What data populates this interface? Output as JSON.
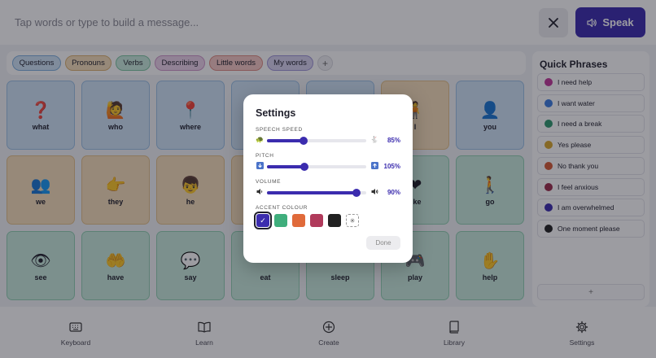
{
  "top": {
    "placeholder": "Tap words or type to build a message...",
    "clear_icon": "close-icon",
    "speak_label": "Speak",
    "speak_icon": "speaker-icon",
    "accent": "#3b2cae"
  },
  "categories": [
    {
      "label": "Questions",
      "color": "#cfe3f7",
      "border": "#7fb0de"
    },
    {
      "label": "Pronouns",
      "color": "#f6dfba",
      "border": "#dcb270"
    },
    {
      "label": "Verbs",
      "color": "#c9ebdc",
      "border": "#7cc6a3"
    },
    {
      "label": "Describing",
      "color": "#ecd2ea",
      "border": "#cf97ca"
    },
    {
      "label": "Little words",
      "color": "#f6c9c4",
      "border": "#df8c83"
    },
    {
      "label": "My words",
      "color": "#d7d2f0",
      "border": "#9f94d8"
    }
  ],
  "add_category_label": "+",
  "tiles": [
    {
      "label": "what",
      "emoji": "❓",
      "cat": "blue"
    },
    {
      "label": "who",
      "emoji": "🙋",
      "cat": "blue"
    },
    {
      "label": "where",
      "emoji": "📍",
      "cat": "blue"
    },
    {
      "label": "",
      "emoji": "",
      "cat": "blue"
    },
    {
      "label": "",
      "emoji": "",
      "cat": "blue"
    },
    {
      "label": "I",
      "emoji": "🧍",
      "cat": "tan"
    },
    {
      "label": "you",
      "emoji": "👤",
      "cat": "blue"
    },
    {
      "label": "we",
      "emoji": "👥",
      "cat": "tan"
    },
    {
      "label": "they",
      "emoji": "👉",
      "cat": "tan"
    },
    {
      "label": "he",
      "emoji": "👦",
      "cat": "tan"
    },
    {
      "label": "",
      "emoji": "",
      "cat": "tan"
    },
    {
      "label": "",
      "emoji": "",
      "cat": "tan"
    },
    {
      "label": "like",
      "emoji": "❤",
      "cat": "green"
    },
    {
      "label": "go",
      "emoji": "🚶",
      "cat": "green"
    },
    {
      "label": "see",
      "emoji": "👁",
      "cat": "green"
    },
    {
      "label": "have",
      "emoji": "🤲",
      "cat": "green"
    },
    {
      "label": "say",
      "emoji": "💬",
      "cat": "green"
    },
    {
      "label": "eat",
      "emoji": "",
      "cat": "green"
    },
    {
      "label": "sleep",
      "emoji": "",
      "cat": "green"
    },
    {
      "label": "play",
      "emoji": "🎮",
      "cat": "green"
    },
    {
      "label": "help",
      "emoji": "✋",
      "cat": "green"
    }
  ],
  "quick_phrases": {
    "title": "Quick Phrases",
    "items": [
      {
        "label": "I need help",
        "color": "#c2389a"
      },
      {
        "label": "I want water",
        "color": "#3b7de0"
      },
      {
        "label": "I need a break",
        "color": "#2f9a6e"
      },
      {
        "label": "Yes please",
        "color": "#d9a72c"
      },
      {
        "label": "No thank you",
        "color": "#d65a35"
      },
      {
        "label": "I feel anxious",
        "color": "#9b2b4a"
      },
      {
        "label": "I am overwhelmed",
        "color": "#3b2cae"
      },
      {
        "label": "One moment please",
        "color": "#222222"
      }
    ],
    "add_label": "+"
  },
  "nav": [
    {
      "label": "Keyboard",
      "icon": "keyboard-icon"
    },
    {
      "label": "Learn",
      "icon": "book-open-icon"
    },
    {
      "label": "Create",
      "icon": "plus-circle-icon"
    },
    {
      "label": "Library",
      "icon": "library-icon"
    },
    {
      "label": "Settings",
      "icon": "gear-icon"
    }
  ],
  "settings": {
    "title": "Settings",
    "speech_speed": {
      "label": "SPEECH SPEED",
      "value_text": "85%",
      "value": 0.37,
      "icon_left": "turtle-icon",
      "icon_right": "rabbit-icon"
    },
    "pitch": {
      "label": "PITCH",
      "value_text": "105%",
      "value": 0.38,
      "icon_left": "pitch-down-icon",
      "icon_right": "pitch-up-icon"
    },
    "volume": {
      "label": "VOLUME",
      "value_text": "90%",
      "value": 0.9,
      "icon_left": "volume-low-icon",
      "icon_right": "volume-high-icon"
    },
    "accent_label": "ACCENT COLOUR",
    "swatches": [
      "#3b2cae",
      "#3fae7c",
      "#e06a3a",
      "#b03a5b",
      "#222222"
    ],
    "selected_swatch": 0,
    "custom_swatch_icon": "sparkle-icon",
    "done_label": "Done"
  }
}
